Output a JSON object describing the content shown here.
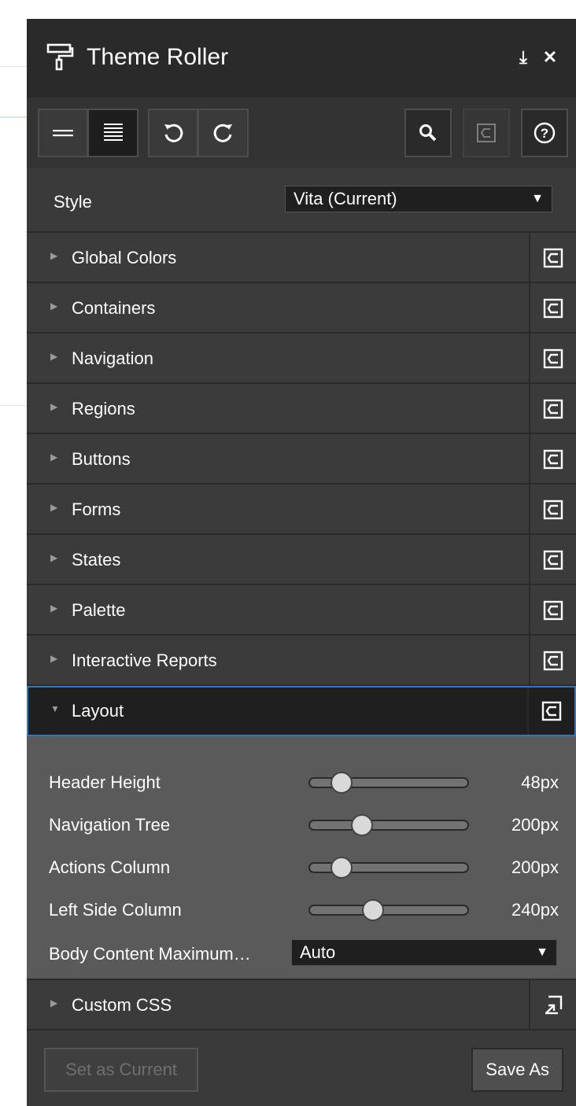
{
  "panel": {
    "title": "Theme Roller",
    "download_glyph": "⤓",
    "close_glyph": "✕"
  },
  "toolbar": {
    "icons": [
      "simple-view-icon",
      "detail-view-icon",
      "undo-icon",
      "redo-icon",
      "search-icon",
      "reset-all-icon",
      "help-icon"
    ]
  },
  "style_select": {
    "label": "Style",
    "value": "Vita (Current)",
    "caret": "▼"
  },
  "sections": [
    {
      "label": "Global Colors",
      "arrow": "▶",
      "open": false
    },
    {
      "label": "Containers",
      "arrow": "▶",
      "open": false
    },
    {
      "label": "Navigation",
      "arrow": "▶",
      "open": false
    },
    {
      "label": "Regions",
      "arrow": "▶",
      "open": false
    },
    {
      "label": "Buttons",
      "arrow": "▶",
      "open": false
    },
    {
      "label": "Forms",
      "arrow": "▶",
      "open": false
    },
    {
      "label": "States",
      "arrow": "▶",
      "open": false
    },
    {
      "label": "Palette",
      "arrow": "▶",
      "open": false
    },
    {
      "label": "Interactive Reports",
      "arrow": "▶",
      "open": false
    },
    {
      "label": "Layout",
      "arrow": "▼",
      "open": true
    },
    {
      "label": "Custom CSS",
      "arrow": "▶",
      "open": false
    }
  ],
  "layout": {
    "sliders": [
      {
        "label": "Header Height",
        "value": "48px",
        "level": 0.2
      },
      {
        "label": "Navigation Tree",
        "value": "200px",
        "level": 0.33
      },
      {
        "label": "Actions Column",
        "value": "200px",
        "level": 0.2
      },
      {
        "label": "Left Side Column",
        "value": "240px",
        "level": 0.4
      }
    ],
    "body_max": {
      "label": "Body Content Maximum…",
      "value": "Auto",
      "caret": "▼"
    }
  },
  "footer": {
    "set_current": "Set as Current",
    "save_as": "Save As"
  },
  "colors": {
    "panel_bg": "#3a3a3a",
    "header_bg": "#2a2a2a",
    "focus_border": "#2f78c4",
    "layout_body_bg": "#5a5a5a"
  }
}
